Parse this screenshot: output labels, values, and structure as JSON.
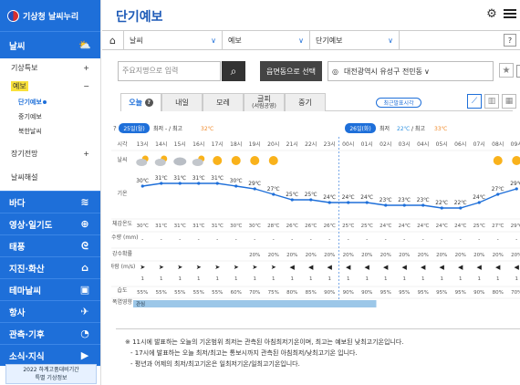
{
  "brand": "기상청 날씨누리",
  "sidebar": {
    "weather": "날씨",
    "items": [
      {
        "label": "기상특보",
        "mark": "+"
      },
      {
        "label": "예보",
        "mark": "−",
        "active": true
      }
    ],
    "leaves": [
      "단기예보",
      "중기예보",
      "북한날씨"
    ],
    "items2": [
      {
        "label": "장기전망",
        "mark": "+"
      },
      {
        "label": "날씨해설",
        "mark": ""
      }
    ],
    "cats": [
      "바다",
      "영상·일기도",
      "태풍",
      "지진·화산",
      "테마날씨",
      "항사",
      "관측·기후",
      "소식·지식"
    ],
    "banner_line1": "2022 하계고품대비기간",
    "banner_line2": "특별 기상정보"
  },
  "main": {
    "title": "단기예보",
    "nav": [
      "날씨",
      "예보",
      "단기예보"
    ],
    "search_placeholder": "주요지명으로 입력",
    "map_btn": "읍면동으로 선택",
    "location": "대전광역시 유성구 전민동",
    "tabs": [
      {
        "label": "오늘",
        "badge": "?"
      },
      {
        "label": "내일"
      },
      {
        "label": "모레"
      },
      {
        "label": "글피",
        "sub": "(서림공영)"
      },
      {
        "label": "중기"
      }
    ],
    "latest": "최근발표시각"
  },
  "forecast": {
    "day1": {
      "date": "25일(월)",
      "min_label": "최저",
      "min": "-",
      "sep": "/",
      "max_label": "최고",
      "max": "32℃"
    },
    "day2": {
      "date": "26일(화)",
      "min_label": "최저",
      "min": "22℃",
      "sep": "/",
      "max_label": "최고",
      "max": "33℃"
    },
    "labels": [
      "시각",
      "날씨",
      "기온",
      "체감온도",
      "강수량 (mm)",
      "강수확률",
      "바람 (m/s)",
      "습도",
      "폭염영향"
    ],
    "times": [
      "13시",
      "14시",
      "15시",
      "16시",
      "17시",
      "18시",
      "19시",
      "20시",
      "21시",
      "22시",
      "23시",
      "00시",
      "01시",
      "02시",
      "03시",
      "04시",
      "05시",
      "06시",
      "07시",
      "08시",
      "09시"
    ],
    "icons": [
      "cloudsun",
      "cloudsun",
      "cloud",
      "cloudsun",
      "sun",
      "sun",
      "sun",
      "sun",
      "moon",
      "moon",
      "moon",
      "moon",
      "moon",
      "moon",
      "moon",
      "moon",
      "moon",
      "moon",
      "moon",
      "sun",
      "sun"
    ],
    "temps": [
      30,
      31,
      31,
      31,
      31,
      30,
      29,
      27,
      25,
      25,
      24,
      24,
      24,
      23,
      23,
      23,
      22,
      22,
      24,
      27,
      29
    ],
    "feels": [
      "30℃",
      "31℃",
      "31℃",
      "31℃",
      "31℃",
      "30℃",
      "30℃",
      "28℃",
      "26℃",
      "26℃",
      "26℃",
      "25℃",
      "25℃",
      "24℃",
      "24℃",
      "24℃",
      "24℃",
      "24℃",
      "25℃",
      "27℃",
      "29℃"
    ],
    "precip": [
      "-",
      "-",
      "-",
      "-",
      "-",
      "-",
      "-",
      "-",
      "-",
      "-",
      "-",
      "-",
      "-",
      "-",
      "-",
      "-",
      "-",
      "-",
      "-",
      "-",
      "-"
    ],
    "pop": [
      "",
      "",
      "",
      "",
      "",
      "",
      "20%",
      "20%",
      "20%",
      "20%",
      "20%",
      "20%",
      "20%",
      "20%",
      "20%",
      "20%",
      "20%",
      "20%",
      "20%",
      "20%",
      "20%"
    ],
    "wind": [
      "1",
      "1",
      "1",
      "1",
      "1",
      "1",
      "1",
      "1",
      "1",
      "1",
      "1",
      "1",
      "1",
      "1",
      "1",
      "1",
      "1",
      "1",
      "1",
      "1",
      "1"
    ],
    "humid": [
      "55%",
      "55%",
      "55%",
      "55%",
      "55%",
      "60%",
      "70%",
      "75%",
      "80%",
      "85%",
      "90%",
      "90%",
      "90%",
      "95%",
      "95%",
      "95%",
      "95%",
      "95%",
      "90%",
      "80%",
      "70%"
    ],
    "heat_label": "관심",
    "temp_colors": {
      "hot": "#f08a2a",
      "cool": "#2a8fe0"
    }
  },
  "notes": [
    "※ 11시에 발표하는 오늘의 기온범위 최저는 관측된 아침최저기온이며, 최고는 예보된 낮최고기온입니다.",
    "- 17시에 발표하는 오늘 최저/최고는 통보시까지 관측된 아침최저/낮최고기온 입니다.",
    "- 평년과 어제의 최저/최고기온은 일최저기온/일최고기온입니다."
  ],
  "colors": {
    "brand": "#1e6fd9",
    "heatbar": "#9cc7e8"
  }
}
